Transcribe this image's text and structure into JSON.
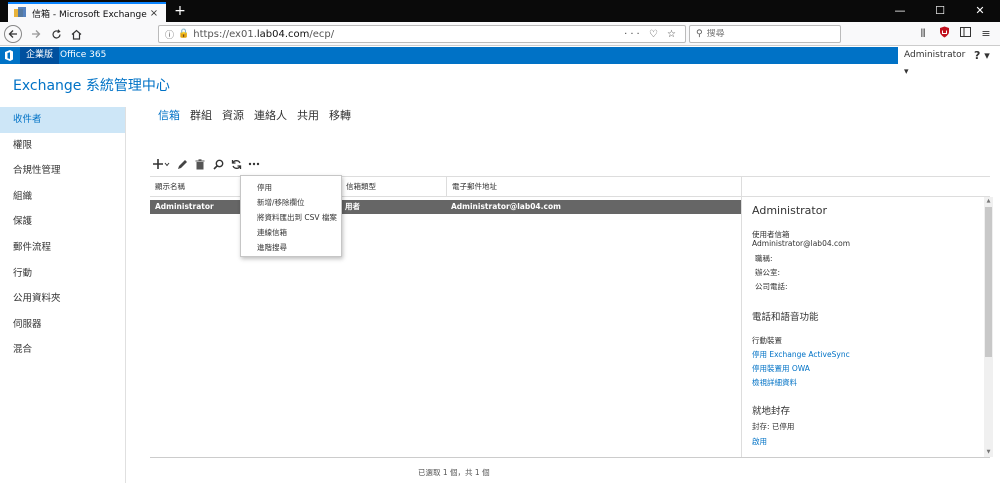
{
  "browser": {
    "tab_title": "信箱 - Microsoft Exchange",
    "tab_close": "×",
    "new_tab": "+",
    "url_prefix": "https://ex01.",
    "url_host": "lab04.com",
    "url_path": "/ecp/",
    "url_actions": "··· ♡ ☆",
    "search_placeholder": "搜尋",
    "window_controls": [
      "—",
      "☐",
      "✕"
    ]
  },
  "o365": {
    "tab_enterprise": "企業版",
    "tab_office": "Office 365",
    "user": "Administrator ▾",
    "help": "? ▾"
  },
  "page": {
    "title": "Exchange 系統管理中心"
  },
  "leftnav": {
    "items": [
      "收件者",
      "權限",
      "合規性管理",
      "組織",
      "保護",
      "郵件流程",
      "行動",
      "公用資料夾",
      "伺服器",
      "混合"
    ],
    "selected": 0
  },
  "subtabs": {
    "items": [
      "信箱",
      "群組",
      "資源",
      "連絡人",
      "共用",
      "移轉"
    ],
    "active": 0
  },
  "table": {
    "columns": [
      "顯示名稱",
      "信箱類型",
      "電子郵件地址"
    ],
    "rows": [
      {
        "display_name": "Administrator",
        "mailbox_type": "用者",
        "email": "Administrator@lab04.com"
      }
    ],
    "status": "已選取 1 個，共 1 個"
  },
  "menu": {
    "items": [
      "停用",
      "新增/移除欄位",
      "將資料匯出到 CSV 檔案",
      "連線信箱",
      "進階搜尋"
    ]
  },
  "details": {
    "name": "Administrator",
    "user_mailbox_label": "使用者信箱",
    "email": "Administrator@lab04.com",
    "title_label": "職稱:",
    "office_label": "辦公室:",
    "phone_label": "公司電話:",
    "section_phone_voice": "電話和語音功能",
    "mobile_devices_label": "行動裝置",
    "link_disable_eas": "停用 Exchange ActiveSync",
    "link_disable_owa": "停用裝置用 OWA",
    "link_view_details": "檢視詳細資料",
    "section_archive": "就地封存",
    "archive_status": "封存:  已停用",
    "link_enable": "啟用"
  },
  "colors": {
    "accent": "#0072c6",
    "selected_row": "#666666",
    "nav_selected_bg": "#cde6f7"
  }
}
